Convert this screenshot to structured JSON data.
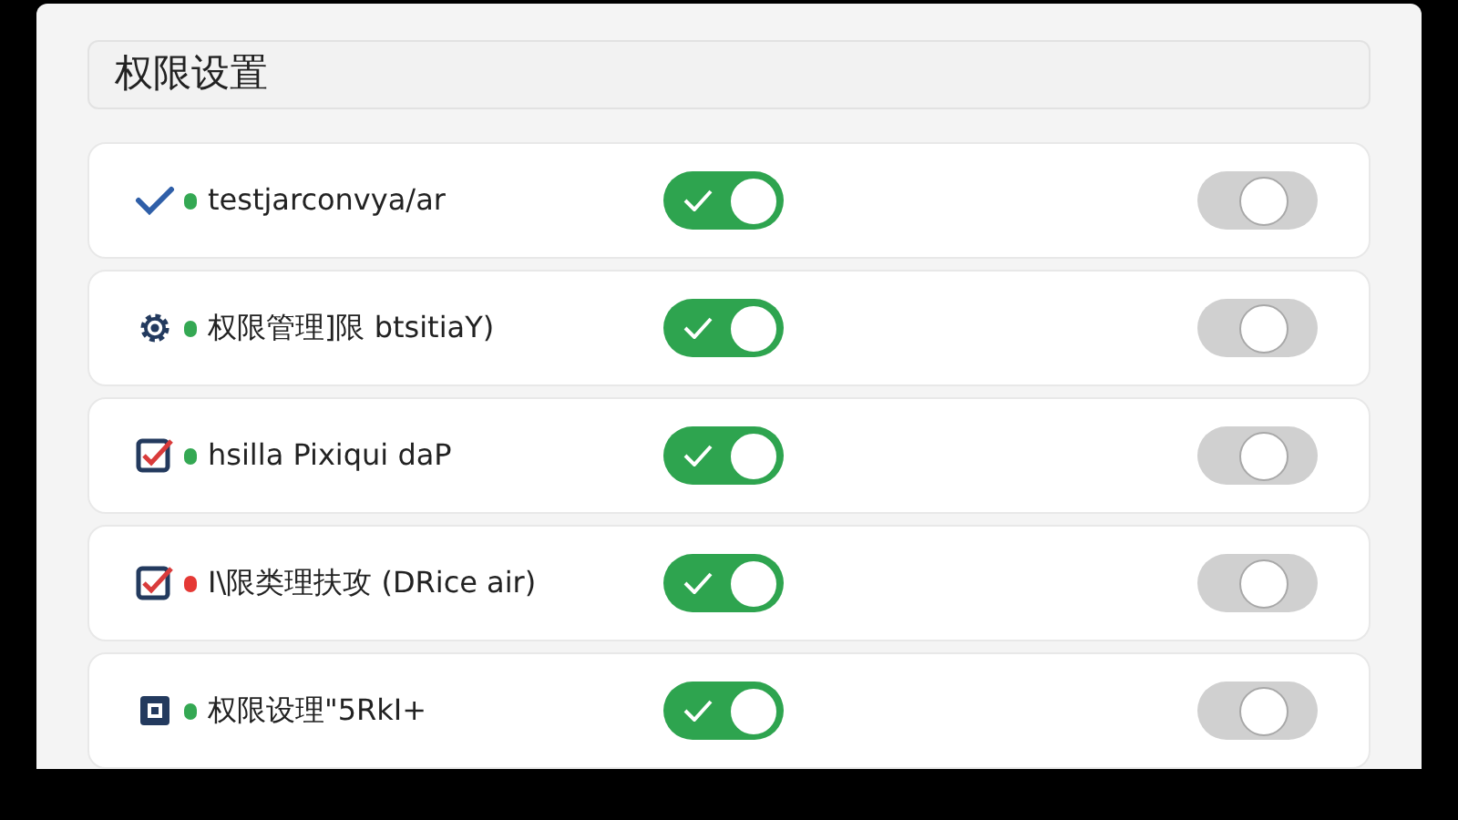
{
  "header": {
    "title": "权限设置"
  },
  "rows": [
    {
      "kind": "check",
      "label": "testjarconvya/ar",
      "color": "#34a853",
      "toggle_1": {
        "on": true
      },
      "toggle_2": {
        "on": false
      }
    },
    {
      "kind": "gear",
      "label": "权限管理]限  btsitiaY)",
      "color": "#34a853",
      "toggle_1": {
        "on": true
      },
      "toggle_2": {
        "on": false
      }
    },
    {
      "kind": "checkbox",
      "label": "hsilla Pixiqui daP",
      "color": "#34a853",
      "toggle_1": {
        "on": true
      },
      "toggle_2": {
        "on": false
      }
    },
    {
      "kind": "checkbox",
      "label": "I\\限类理扶攻 (DRice air)",
      "color": "#e53935",
      "toggle_1": {
        "on": true
      },
      "toggle_2": {
        "on": false
      }
    },
    {
      "kind": "chip",
      "label": "权限设理\"5RkI+",
      "color": "#34a853",
      "toggle_1": {
        "on": true
      },
      "toggle_2": {
        "on": false
      }
    }
  ]
}
